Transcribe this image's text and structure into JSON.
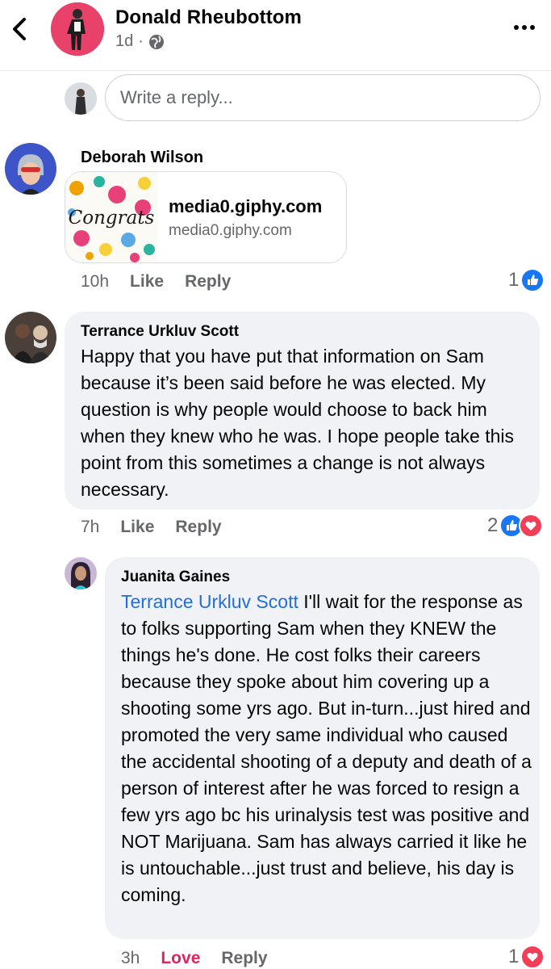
{
  "header": {
    "poster_name": "Donald Rheubottom",
    "time": "1d",
    "separator": "·",
    "back_icon": "chevron-left-icon",
    "more_icon": "more-horizontal-icon",
    "privacy_icon": "globe-icon"
  },
  "reply": {
    "placeholder": "Write a reply..."
  },
  "comments": [
    {
      "author": "Deborah Wilson",
      "link": {
        "title": "media0.giphy.com",
        "subtitle": "media0.giphy.com",
        "thumb_text": "Congrats"
      },
      "time": "10h",
      "like_label": "Like",
      "reply_label": "Reply",
      "reaction_count": "1",
      "reactions": [
        "like"
      ]
    },
    {
      "author": "Terrance Urkluv Scott",
      "text": "Happy that you have put that information on Sam because it’s been said before he was elected. My question is why people would choose to back him when they knew who he was. I hope people take this point from this sometimes a change is not always necessary.",
      "time": "7h",
      "like_label": "Like",
      "reply_label": "Reply",
      "reaction_count": "2",
      "reactions": [
        "like",
        "love"
      ]
    },
    {
      "author": "Juanita Gaines",
      "mention": "Terrance Urkluv Scott",
      "text": " I'll wait for the response as to folks supporting Sam when they KNEW the things he's done. He cost folks their careers because they spoke about him covering up a shooting some yrs ago. But in-turn...just hired and promoted the very same individual who caused the accidental shooting of a deputy and death of a person of interest after he was forced to resign a few yrs ago bc his urinalysis test was positive and NOT Marijuana. Sam has always carried it like he is untouchable...just trust and believe, his day is coming.",
      "time": "3h",
      "like_label": "Love",
      "reply_label": "Reply",
      "reaction_count": "1",
      "reactions": [
        "love"
      ]
    }
  ],
  "colors": {
    "link_blue": "#216fdb",
    "like_blue": "#1877f2",
    "love_red": "#f33e58",
    "bubble_gray": "#f0f2f5"
  }
}
